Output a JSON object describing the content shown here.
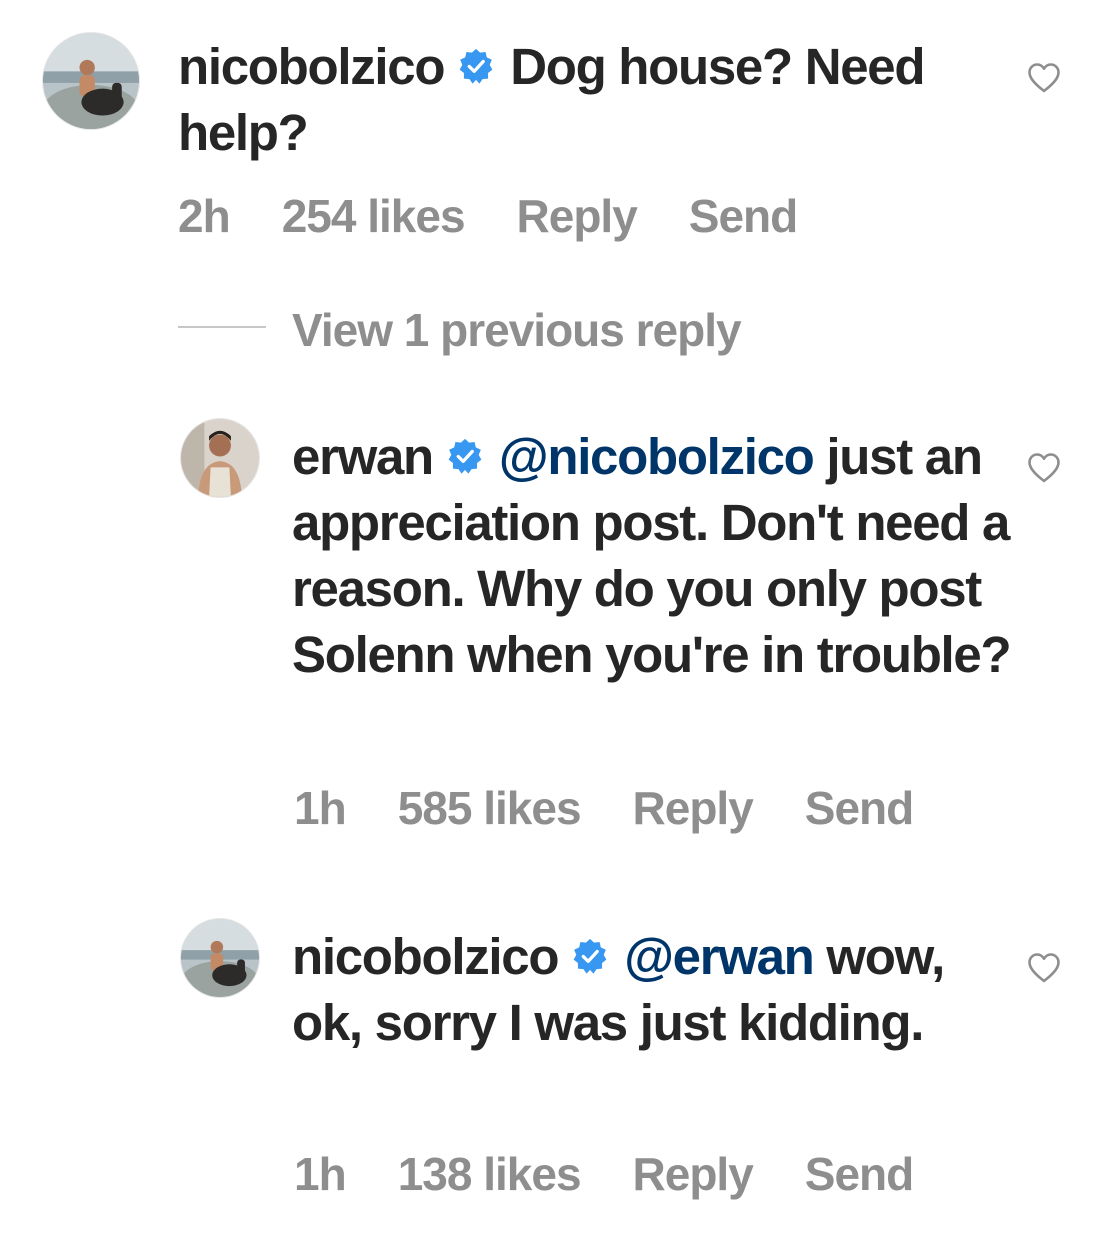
{
  "comments": [
    {
      "username": "nicobolzico",
      "verified": true,
      "mention": "",
      "text": "Dog house? Need help?",
      "time": "2h",
      "likes": "254 likes",
      "reply_label": "Reply",
      "send_label": "Send"
    },
    {
      "username": "erwan",
      "verified": true,
      "mention": "@nicobolzico",
      "text": "just an appreciation post. Don't need a reason. Why do you only post Solenn when you're in trouble?",
      "time": "1h",
      "likes": "585 likes",
      "reply_label": "Reply",
      "send_label": "Send"
    },
    {
      "username": "nicobolzico",
      "verified": true,
      "mention": "@erwan",
      "text": "wow, ok, sorry I was just kidding.",
      "time": "1h",
      "likes": "138 likes",
      "reply_label": "Reply",
      "send_label": "Send"
    }
  ],
  "view_replies_label": "View 1 previous reply",
  "icons": {
    "verified": "verified-badge-icon",
    "like": "heart-outline-icon"
  },
  "colors": {
    "text": "#262626",
    "muted": "#8e8e8e",
    "mention": "#003569",
    "verified": "#3897f0"
  }
}
